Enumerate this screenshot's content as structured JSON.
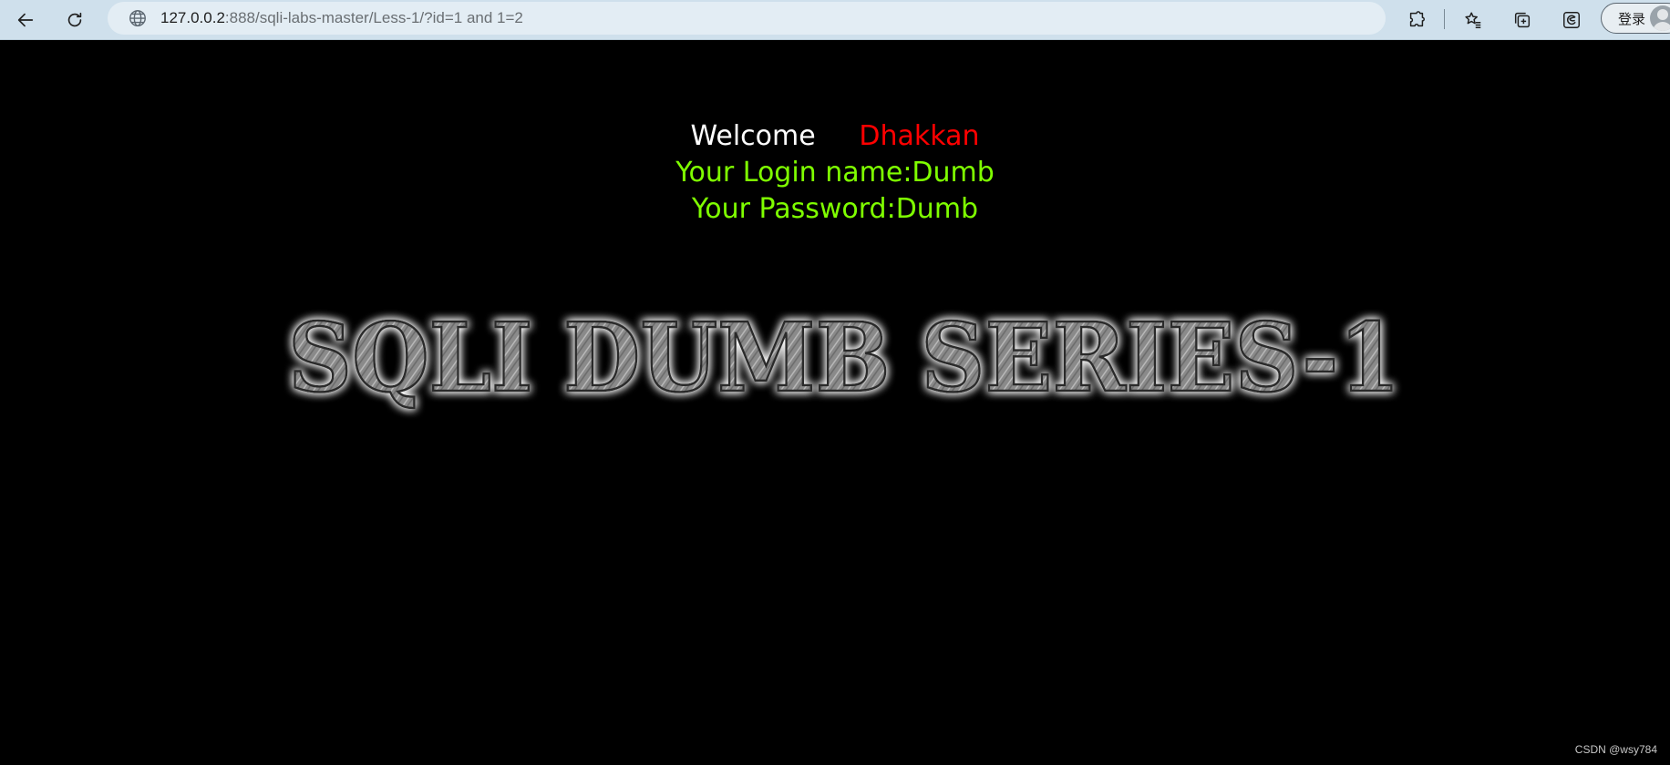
{
  "browser": {
    "url_host": "127.0.0.2",
    "url_rest": ":888/sqli-labs-master/Less-1/?id=1 and 1=2",
    "login_label": "登录",
    "icons": [
      "back-icon",
      "refresh-icon",
      "globe-icon",
      "extensions-icon",
      "favorites-icon",
      "collections-icon",
      "edge-icon",
      "avatar"
    ]
  },
  "page": {
    "welcome": "Welcome",
    "name": "Dhakkan",
    "login_line": "Your Login name:Dumb",
    "password_line": "Your Password:Dumb",
    "banner_text": "SQLI DUMB SERIES-1",
    "colors": {
      "background": "#000000",
      "welcome": "#ffffff",
      "name": "#ff0000",
      "info": "#7fff00"
    }
  },
  "watermark": "CSDN @wsy784"
}
